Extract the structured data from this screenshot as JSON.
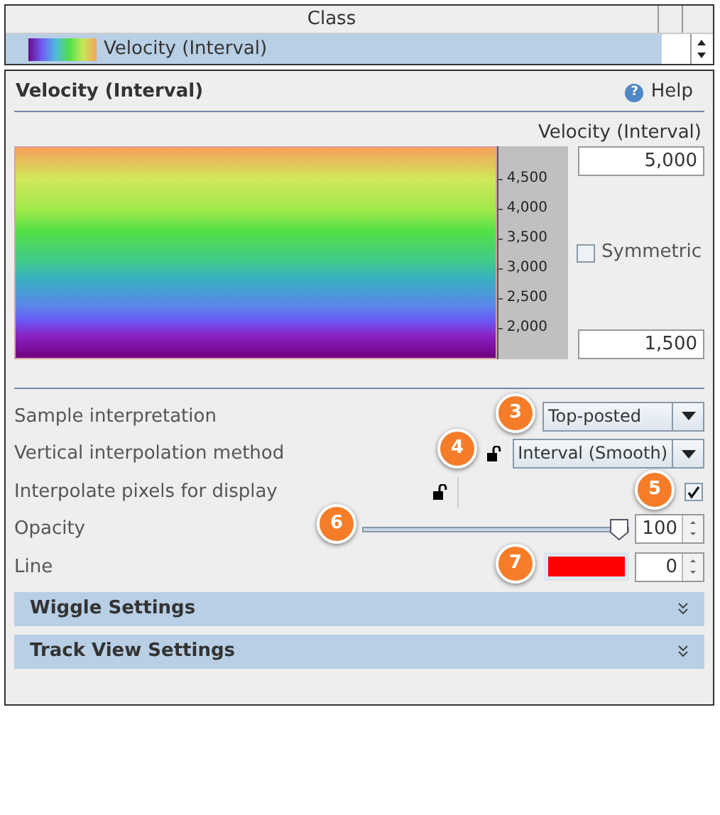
{
  "class_table": {
    "column": "Class",
    "rows": [
      {
        "label": "Velocity (Interval)",
        "selected": true
      }
    ]
  },
  "panel": {
    "title": "Velocity (Interval)",
    "help_icon": "?",
    "help": "Help"
  },
  "color_scale": {
    "label": "Velocity (Interval)",
    "max": "5,000",
    "min": "1,500",
    "ticks": [
      "4,500",
      "4,000",
      "3,500",
      "3,000",
      "2,500",
      "2,000"
    ],
    "symmetric": {
      "label": "Symmetric",
      "checked": false
    }
  },
  "settings": [
    {
      "kind": "dropdown",
      "label": "Sample interpretation",
      "value": "Top-posted"
    },
    {
      "kind": "dropdown",
      "label": "Vertical interpolation method",
      "value": "Interval (Smooth)",
      "lock": true
    },
    {
      "kind": "checkbox",
      "label": "Interpolate pixels for display",
      "checked": true,
      "lock": true
    },
    {
      "kind": "slider",
      "label": "Opacity",
      "level": 1.0,
      "value": "100"
    },
    {
      "kind": "color",
      "label": "Line",
      "color": "#ff0000",
      "value": "0"
    }
  ],
  "sections": [
    {
      "title": "Wiggle Settings",
      "expanded": false
    },
    {
      "title": "Track View Settings",
      "expanded": false
    }
  ],
  "callouts": [
    "3",
    "4",
    "5",
    "6",
    "7"
  ]
}
